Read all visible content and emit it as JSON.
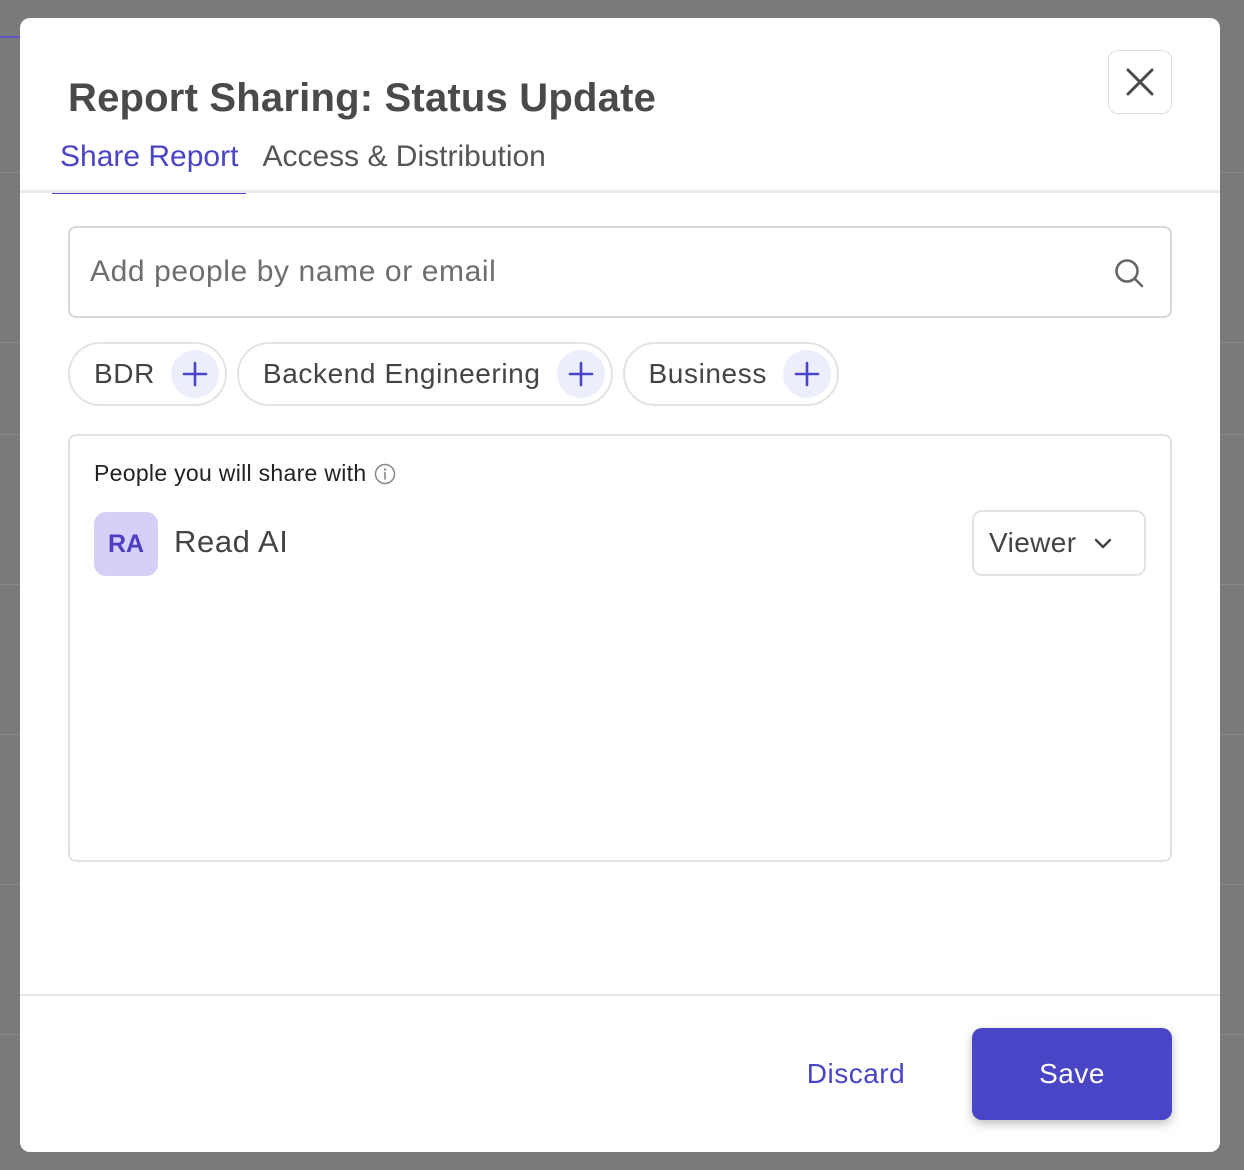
{
  "dialog": {
    "title": "Report Sharing: Status Update",
    "close_icon": "close-icon"
  },
  "tabs": [
    {
      "label": "Share Report",
      "active": true
    },
    {
      "label": "Access & Distribution",
      "active": false
    }
  ],
  "search": {
    "placeholder": "Add people by name or email",
    "value": "",
    "icon": "search-icon"
  },
  "groups": [
    {
      "label": "BDR",
      "icon": "plus-icon"
    },
    {
      "label": "Backend Engineering",
      "icon": "plus-icon"
    },
    {
      "label": "Business",
      "icon": "plus-icon"
    }
  ],
  "share_list": {
    "heading": "People you will share with",
    "info_icon": "info-icon",
    "people": [
      {
        "initials": "RA",
        "name": "Read AI",
        "role": "Viewer"
      }
    ]
  },
  "footer": {
    "discard_label": "Discard",
    "save_label": "Save"
  },
  "colors": {
    "accent": "#4a44c6",
    "avatar_bg": "#d6cff6",
    "chip_add_bg": "#eceefc",
    "overlay": "#7a7a7a"
  }
}
